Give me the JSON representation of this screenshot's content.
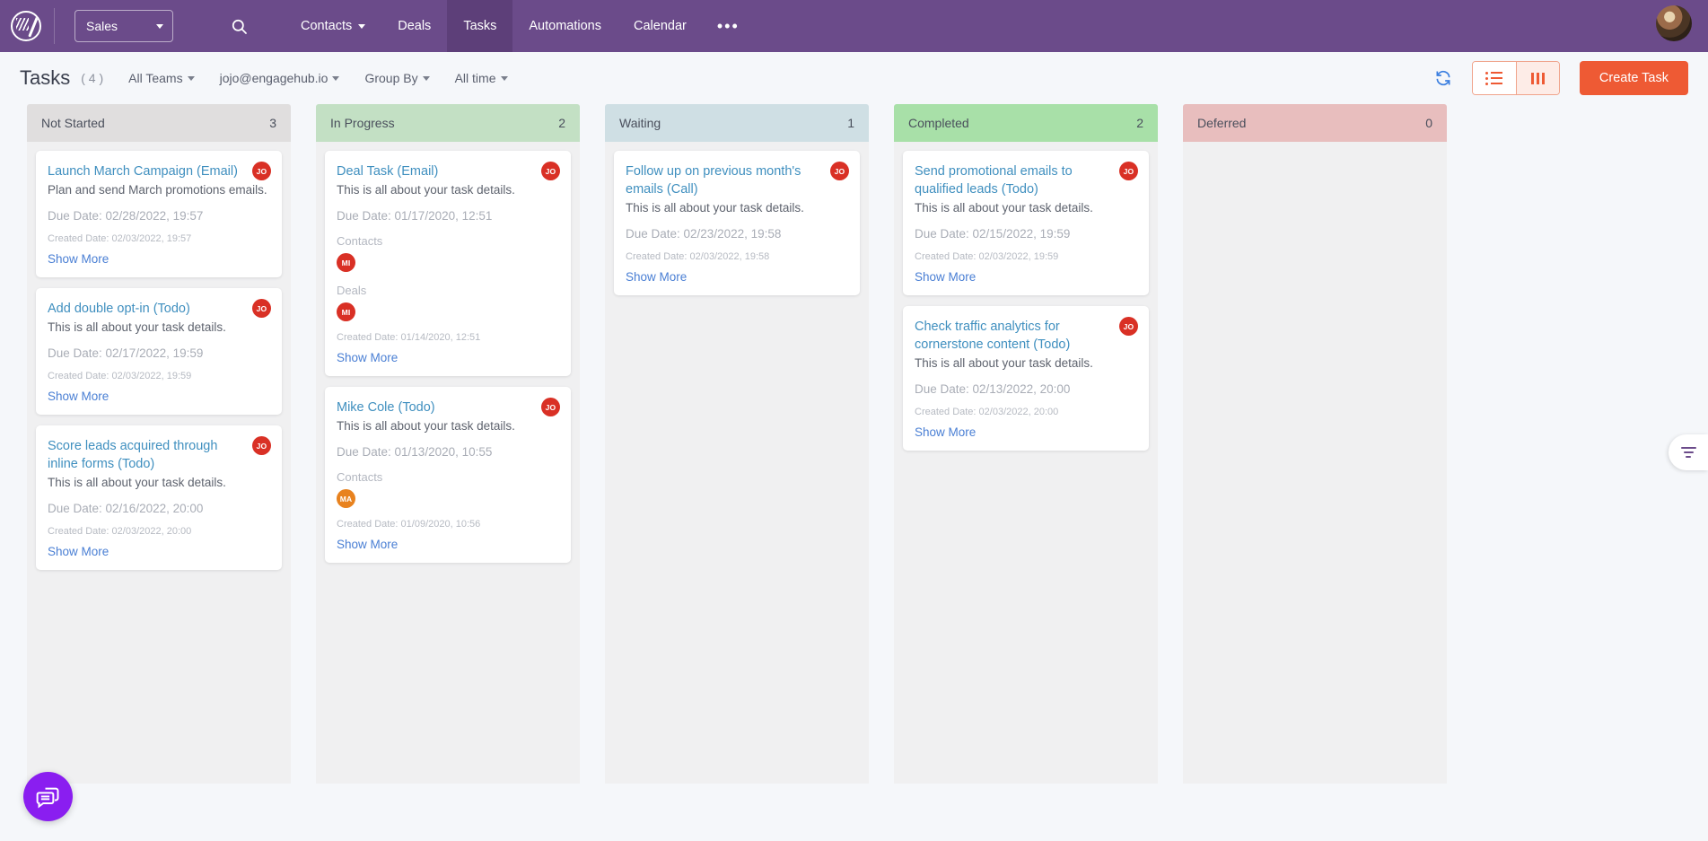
{
  "topnav": {
    "logo_name": "engagebay-logo",
    "app_selector": {
      "label": "Sales"
    },
    "search_icon": "search-icon",
    "items": [
      {
        "label": "Contacts",
        "has_caret": true,
        "active": false
      },
      {
        "label": "Deals",
        "has_caret": false,
        "active": false
      },
      {
        "label": "Tasks",
        "has_caret": false,
        "active": true
      },
      {
        "label": "Automations",
        "has_caret": false,
        "active": false
      },
      {
        "label": "Calendar",
        "has_caret": false,
        "active": false
      }
    ],
    "more_label": "•••",
    "avatar_name": "user-profile-avatar"
  },
  "toolbar": {
    "title": "Tasks",
    "count": "( 4 )",
    "filters": [
      {
        "label": "All Teams"
      },
      {
        "label": "jojo@engagehub.io"
      },
      {
        "label": "Group By"
      },
      {
        "label": "All time"
      }
    ],
    "refresh_icon": "refresh-icon",
    "views": [
      {
        "name": "list-view",
        "icon": "list-icon",
        "active": false
      },
      {
        "name": "kanban-view",
        "icon": "columns-icon",
        "active": true
      }
    ],
    "create_label": "Create Task"
  },
  "board": {
    "columns": [
      {
        "title": "Not Started",
        "count": "3",
        "color": "#e0dede",
        "cards": [
          {
            "title": "Launch March Campaign (Email)",
            "description": "Plan and send March promotions emails.",
            "due": "Due Date: 02/28/2022, 19:57",
            "created": "Created Date: 02/03/2022, 19:57",
            "show_more": "Show More",
            "owner": {
              "initials": "JO",
              "color": "#d93025"
            },
            "relations": []
          },
          {
            "title": "Add double opt-in (Todo)",
            "description": "This is all about your task details.",
            "due": "Due Date: 02/17/2022, 19:59",
            "created": "Created Date: 02/03/2022, 19:59",
            "show_more": "Show More",
            "owner": {
              "initials": "JO",
              "color": "#d93025"
            },
            "relations": []
          },
          {
            "title": "Score leads acquired through inline forms (Todo)",
            "description": "This is all about your task details.",
            "due": "Due Date: 02/16/2022, 20:00",
            "created": "Created Date: 02/03/2022, 20:00",
            "show_more": "Show More",
            "owner": {
              "initials": "JO",
              "color": "#d93025"
            },
            "relations": []
          }
        ]
      },
      {
        "title": "In Progress",
        "count": "2",
        "color": "#c3e0c4",
        "cards": [
          {
            "title": "Deal Task (Email)",
            "description": "This is all about your task details.",
            "due": "Due Date: 01/17/2020, 12:51",
            "created": "Created Date: 01/14/2020, 12:51",
            "show_more": "Show More",
            "owner": {
              "initials": "JO",
              "color": "#d93025"
            },
            "relations": [
              {
                "label": "Contacts",
                "initials": "MI",
                "color": "#d93025"
              },
              {
                "label": "Deals",
                "initials": "MI",
                "color": "#d93025"
              }
            ]
          },
          {
            "title": "Mike Cole (Todo)",
            "description": "This is all about your task details.",
            "due": "Due Date: 01/13/2020, 10:55",
            "created": "Created Date: 01/09/2020, 10:56",
            "show_more": "Show More",
            "owner": {
              "initials": "JO",
              "color": "#d93025"
            },
            "relations": [
              {
                "label": "Contacts",
                "initials": "MA",
                "color": "#e8821e"
              }
            ]
          }
        ]
      },
      {
        "title": "Waiting",
        "count": "1",
        "color": "#cfdfe4",
        "cards": [
          {
            "title": "Follow up on previous month's emails (Call)",
            "description": "This is all about your task details.",
            "due": "Due Date: 02/23/2022, 19:58",
            "created": "Created Date: 02/03/2022, 19:58",
            "show_more": "Show More",
            "owner": {
              "initials": "JO",
              "color": "#d93025"
            },
            "relations": []
          }
        ]
      },
      {
        "title": "Completed",
        "count": "2",
        "color": "#a8e0a8",
        "cards": [
          {
            "title": "Send promotional emails to qualified leads (Todo)",
            "description": "This is all about your task details.",
            "due": "Due Date: 02/15/2022, 19:59",
            "created": "Created Date: 02/03/2022, 19:59",
            "show_more": "Show More",
            "owner": {
              "initials": "JO",
              "color": "#d93025"
            },
            "relations": []
          },
          {
            "title": "Check traffic analytics for cornerstone content (Todo)",
            "description": "This is all about your task details.",
            "due": "Due Date: 02/13/2022, 20:00",
            "created": "Created Date: 02/03/2022, 20:00",
            "show_more": "Show More",
            "owner": {
              "initials": "JO",
              "color": "#d93025"
            },
            "relations": []
          }
        ]
      },
      {
        "title": "Deferred",
        "count": "0",
        "color": "#e8bebe",
        "cards": []
      }
    ]
  },
  "floating": {
    "filter_tab_icon": "filter-funnel-icon",
    "chat_icon": "chat-message-icon"
  },
  "colors": {
    "brand_purple": "#6b4b8a",
    "accent_orange": "#ee5a34",
    "link_blue": "#3f8fbf",
    "page_bg": "#f5f7fa",
    "column_bg": "#f0f0f1"
  }
}
